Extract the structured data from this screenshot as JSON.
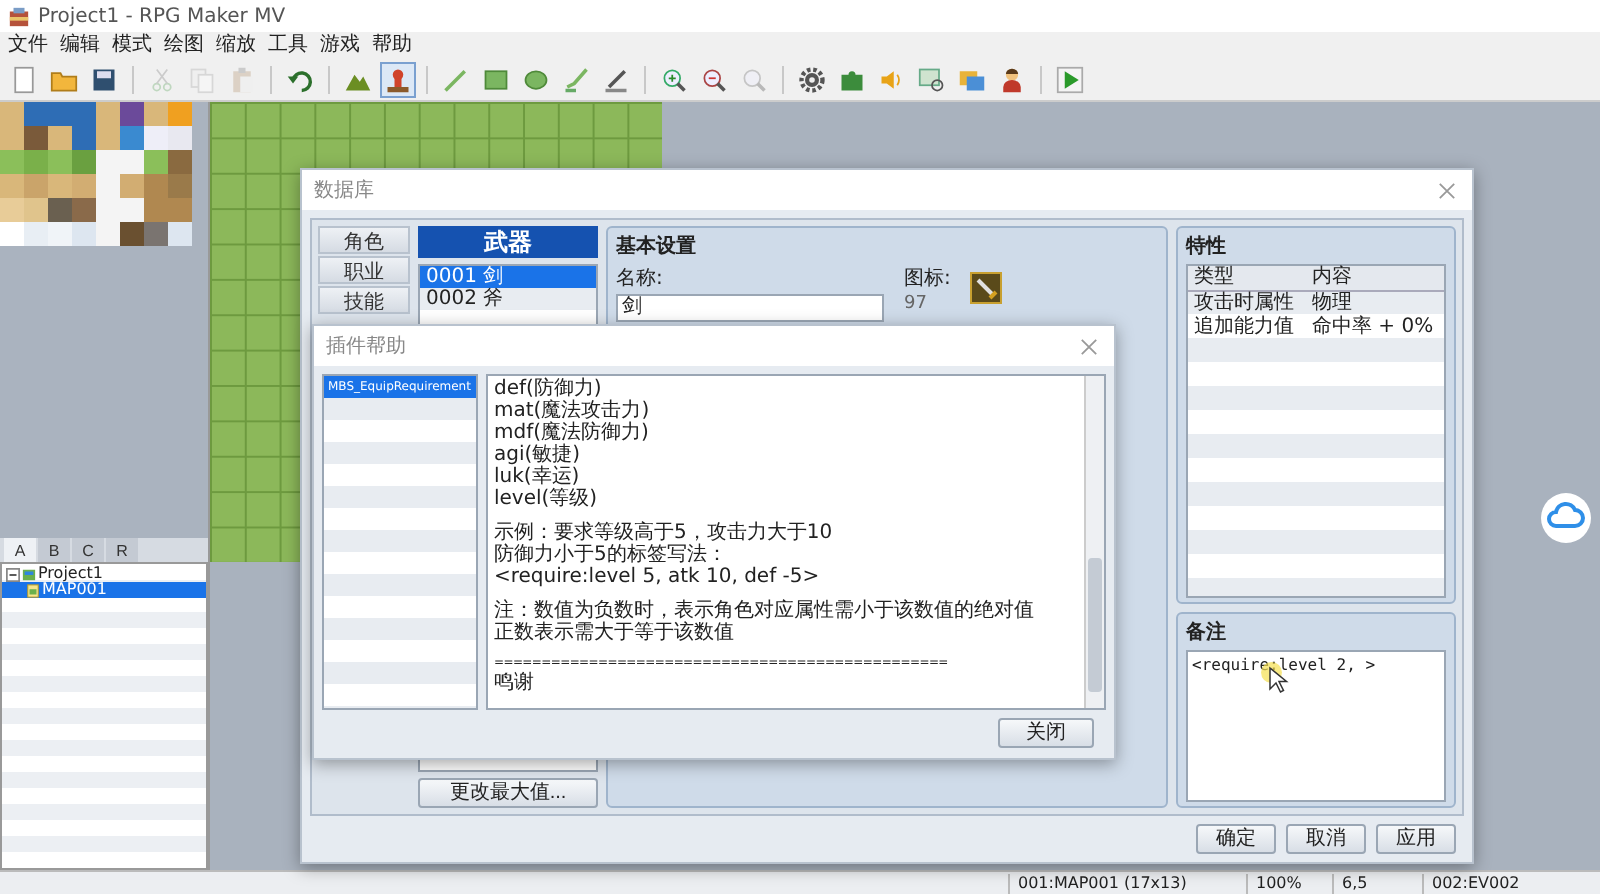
{
  "window": {
    "title": "Project1 - RPG Maker MV"
  },
  "menu": [
    "文件",
    "编辑",
    "模式",
    "绘图",
    "缩放",
    "工具",
    "游戏",
    "帮助"
  ],
  "toolbar": [
    {
      "items": [
        {
          "kind": "new",
          "selected": false,
          "disabled": false
        },
        {
          "kind": "open",
          "selected": false,
          "disabled": false
        },
        {
          "kind": "save",
          "selected": false,
          "disabled": false
        }
      ]
    },
    {
      "items": [
        {
          "kind": "cut",
          "selected": false,
          "disabled": true
        },
        {
          "kind": "copy",
          "selected": false,
          "disabled": true
        },
        {
          "kind": "paste",
          "selected": false,
          "disabled": true
        }
      ]
    },
    {
      "items": [
        {
          "kind": "undo",
          "selected": false,
          "disabled": false
        }
      ]
    },
    {
      "items": [
        {
          "kind": "map",
          "selected": false,
          "disabled": false
        },
        {
          "kind": "event",
          "selected": true,
          "disabled": false
        }
      ]
    },
    {
      "items": [
        {
          "kind": "pencil",
          "selected": false,
          "disabled": false
        },
        {
          "kind": "rect",
          "selected": false,
          "disabled": false
        },
        {
          "kind": "ellipse",
          "selected": false,
          "disabled": false
        },
        {
          "kind": "fill",
          "selected": false,
          "disabled": false
        },
        {
          "kind": "shadow",
          "selected": false,
          "disabled": false
        }
      ]
    },
    {
      "items": [
        {
          "kind": "zoom-in",
          "selected": false,
          "disabled": false
        },
        {
          "kind": "zoom-out",
          "selected": false,
          "disabled": false
        },
        {
          "kind": "zoom-reset",
          "selected": false,
          "disabled": true
        }
      ]
    },
    {
      "items": [
        {
          "kind": "database",
          "selected": false,
          "disabled": false
        },
        {
          "kind": "plugin",
          "selected": false,
          "disabled": false
        },
        {
          "kind": "sound",
          "selected": false,
          "disabled": false
        },
        {
          "kind": "search",
          "selected": false,
          "disabled": false
        },
        {
          "kind": "resource",
          "selected": false,
          "disabled": false
        },
        {
          "kind": "character",
          "selected": false,
          "disabled": false
        }
      ]
    },
    {
      "items": [
        {
          "kind": "play",
          "selected": false,
          "disabled": false
        }
      ]
    }
  ],
  "tileset_tabs": [
    {
      "label": "A",
      "selected": true
    },
    {
      "label": "B",
      "selected": false
    },
    {
      "label": "C",
      "selected": false
    },
    {
      "label": "R",
      "selected": false
    }
  ],
  "map_tree": [
    {
      "label": "Project1",
      "selected": false,
      "expanded": true,
      "children": [
        {
          "label": "MAP001",
          "selected": true
        }
      ]
    }
  ],
  "status_bar": [
    "001:MAP001 (17x13)",
    "100%",
    "6,5",
    "002:EV002"
  ],
  "database": {
    "title": "数据库",
    "categories": [
      {
        "label": "角色",
        "selected": false
      },
      {
        "label": "职业",
        "selected": false
      },
      {
        "label": "技能",
        "selected": false
      }
    ],
    "list_header": "武器",
    "items": [
      {
        "label": "0001 剑",
        "selected": true
      },
      {
        "label": "0002 斧",
        "selected": false
      }
    ],
    "change_max_button": "更改最大值...",
    "basic": {
      "title": "基本设置",
      "name_label": "名称:",
      "name_value": "剑",
      "icon_label": "图标:",
      "icon_index": "97"
    },
    "traits": {
      "title": "特性",
      "columns": [
        "类型",
        "内容"
      ],
      "rows": [
        [
          "攻击时属性",
          "物理"
        ],
        [
          "追加能力值",
          "命中率 + 0%"
        ]
      ]
    },
    "note": {
      "title": "备注",
      "value": "<require:level 2, >"
    },
    "buttons": [
      "确定",
      "取消",
      "应用"
    ]
  },
  "plugin_help": {
    "title": "插件帮助",
    "plugins": [
      {
        "label": "MBS_EquipRequirement",
        "selected": true
      }
    ],
    "paragraphs": [
      {
        "lines": [
          "def(防御力)",
          "mat(魔法攻击力)",
          "mdf(魔法防御力)",
          "agi(敏捷)",
          "luk(幸运)",
          "level(等级)"
        ]
      },
      {
        "lines": [
          "示例：要求等级高于5，攻击力大于10",
          "防御力小于5的标签写法：",
          "<require:level 5, atk 10, def -5>"
        ]
      },
      {
        "lines": [
          "注：数值为负数时，表示角色对应属性需小于该数值的绝对值",
          "正数表示需大于等于该数值"
        ]
      },
      {
        "rule": "================================================",
        "lines": [
          "鸣谢"
        ]
      }
    ],
    "close_button": "关闭"
  }
}
